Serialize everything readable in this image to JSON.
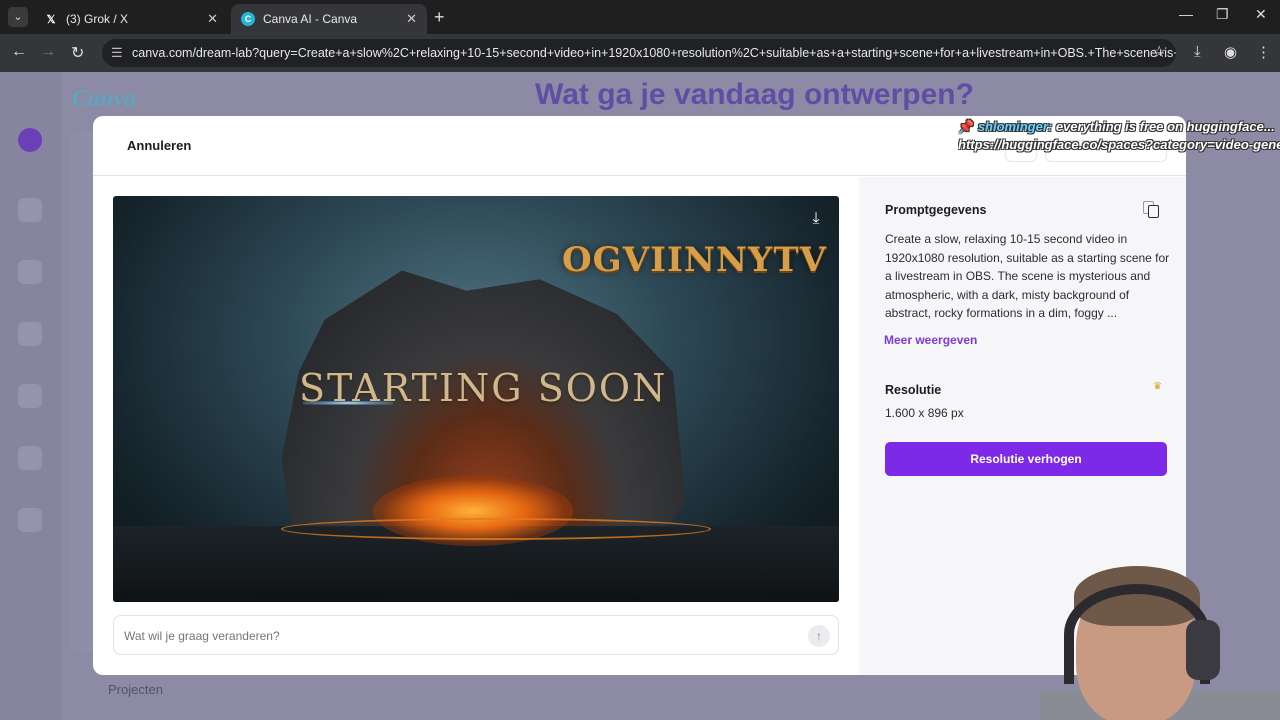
{
  "browser": {
    "tabs": [
      {
        "title": "(3) Grok / X",
        "favicon": "x-logo"
      },
      {
        "title": "Canva AI - Canva",
        "favicon": "canva-logo"
      }
    ],
    "new_tab_label": "+",
    "url": "canva.com/dream-lab?query=Create+a+slow%2C+relaxing+10-15+second+video+in+1920x1080+resolution%2C+suitable+as+a+starting+scene+for+a+livestream+in+OBS.+The+scene+is+my..."
  },
  "background_page": {
    "logo": "Canva",
    "headline": "Wat ga je vandaag ontwerpen?",
    "projects_label": "Projecten"
  },
  "modal": {
    "cancel_label": "Annuleren",
    "preview": {
      "brand_text": "OGVIINNYTV",
      "title_text": "STARTING SOON"
    },
    "prompt_input_placeholder": "Wat wil je graag veranderen?",
    "details": {
      "prompt_heading": "Promptgegevens",
      "prompt_text": "Create a slow, relaxing 10-15 second video in 1920x1080 resolution, suitable as a starting scene for a livestream in OBS. The scene is mysterious and atmospheric, with a dark, misty background of abstract, rocky formations in a dim, foggy ...",
      "show_more_label": "Meer weergeven",
      "resolution_heading": "Resolutie",
      "resolution_value": "1.600 x 896 px",
      "upgrade_button_label": "Resolutie verhogen"
    }
  },
  "overlay": {
    "ticker_user": "shlominger:",
    "ticker_message": " everything is free on huggingface...",
    "ticker_url": "https://huggingface.co/spaces?category=video-gene"
  },
  "colors": {
    "accent": "#7d2ae8",
    "link": "#7b3bd6"
  }
}
